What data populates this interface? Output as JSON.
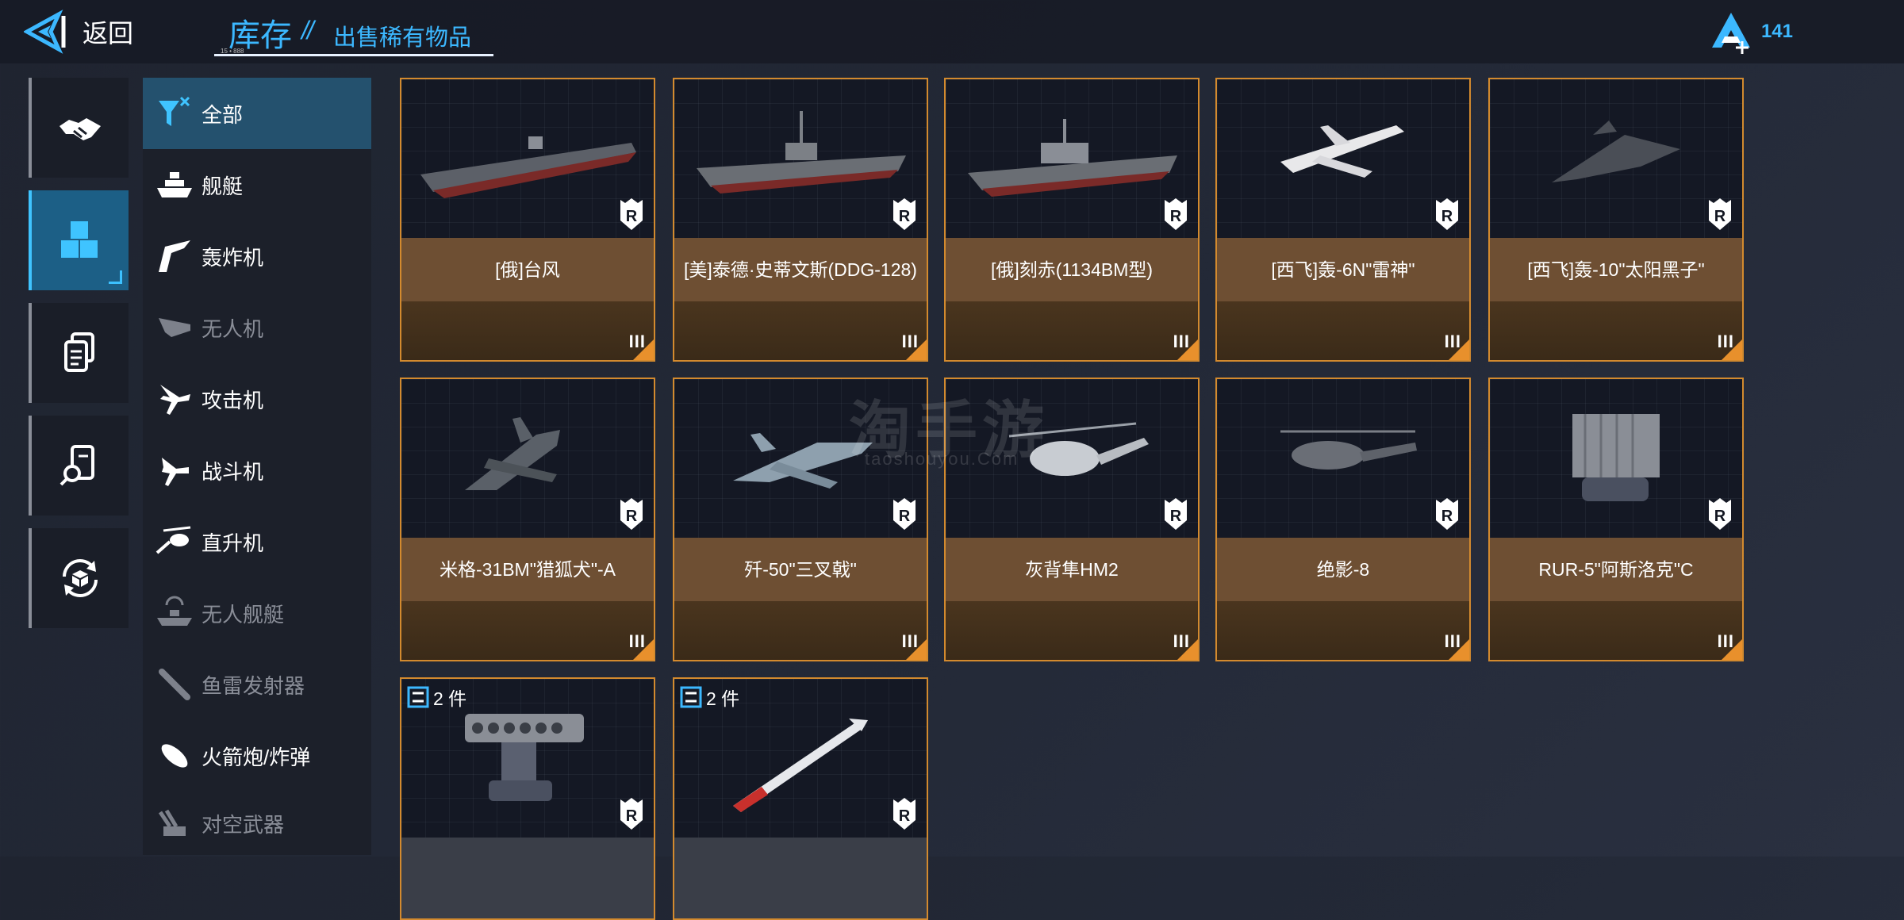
{
  "header": {
    "back_label": "返回",
    "title": "库存",
    "title_separator": "//",
    "subtitle": "出售稀有物品",
    "tiny_text": "15 • 888",
    "currency_value": "141"
  },
  "left_rail": [
    {
      "name": "trade",
      "active": false
    },
    {
      "name": "inventory",
      "active": true
    },
    {
      "name": "documents",
      "active": false
    },
    {
      "name": "search-records",
      "active": false
    },
    {
      "name": "exchange",
      "active": false
    }
  ],
  "categories": [
    {
      "label": "全部",
      "icon": "all-filter-icon",
      "active": true,
      "dim": false
    },
    {
      "label": "舰艇",
      "icon": "ship-icon",
      "active": false,
      "dim": false
    },
    {
      "label": "轰炸机",
      "icon": "bomber-icon",
      "active": false,
      "dim": false
    },
    {
      "label": "无人机",
      "icon": "drone-icon",
      "active": false,
      "dim": true
    },
    {
      "label": "攻击机",
      "icon": "attack-jet-icon",
      "active": false,
      "dim": false
    },
    {
      "label": "战斗机",
      "icon": "fighter-jet-icon",
      "active": false,
      "dim": false
    },
    {
      "label": "直升机",
      "icon": "helicopter-icon",
      "active": false,
      "dim": false
    },
    {
      "label": "无人舰艇",
      "icon": "unmanned-ship-icon",
      "active": false,
      "dim": true
    },
    {
      "label": "鱼雷发射器",
      "icon": "torpedo-icon",
      "active": false,
      "dim": true
    },
    {
      "label": "火箭炮/炸弹",
      "icon": "rocket-icon",
      "active": false,
      "dim": false
    },
    {
      "label": "对空武器",
      "icon": "anti-air-icon",
      "active": false,
      "dim": true
    }
  ],
  "items": [
    {
      "name": "[俄]台风",
      "tier": "III",
      "badge": "R",
      "kind": "carrier"
    },
    {
      "name": "[美]泰德·史蒂文斯(DDG-128)",
      "tier": "III",
      "badge": "R",
      "kind": "destroyer"
    },
    {
      "name": "[俄]刻赤(1134BM型)",
      "tier": "III",
      "badge": "R",
      "kind": "cruiser"
    },
    {
      "name": "[西飞]轰-6N\"雷神\"",
      "tier": "III",
      "badge": "R",
      "kind": "bomber"
    },
    {
      "name": "[西飞]轰-10\"太阳黑子\"",
      "tier": "III",
      "badge": "R",
      "kind": "stealth-bomber"
    },
    {
      "name": "米格-31BM\"猎狐犬\"-A",
      "tier": "III",
      "badge": "R",
      "kind": "fighter"
    },
    {
      "name": "歼-50\"三叉戟\"",
      "tier": "III",
      "badge": "R",
      "kind": "fighter2"
    },
    {
      "name": "灰背隼HM2",
      "tier": "III",
      "badge": "R",
      "kind": "helicopter"
    },
    {
      "name": "绝影-8",
      "tier": "III",
      "badge": "R",
      "kind": "helicopter2"
    },
    {
      "name": "RUR-5\"阿斯洛克\"C",
      "tier": "III",
      "badge": "R",
      "kind": "launcher-box"
    },
    {
      "count": "2 件",
      "badge": "R",
      "kind": "rocket-launcher"
    },
    {
      "count": "2 件",
      "badge": "R",
      "kind": "missile"
    }
  ],
  "watermark": {
    "main": "淘手游",
    "sub": "taoshouyou.Com"
  },
  "colors": {
    "accent": "#3cb8ff",
    "card_border": "#d38a2e",
    "name_band": "#6e4f33",
    "active_tab": "#24516e"
  }
}
